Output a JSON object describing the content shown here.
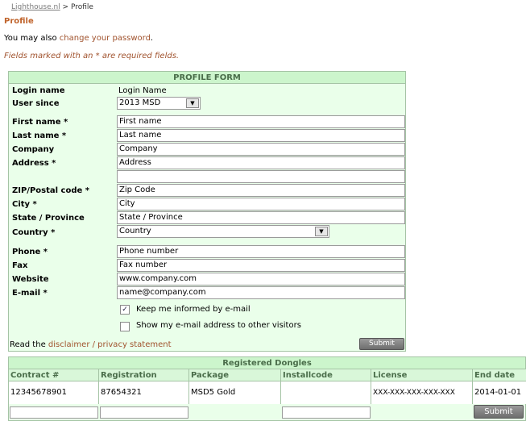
{
  "breadcrumb": {
    "home": "Lighthouse.nl",
    "separator": ">",
    "current": "Profile"
  },
  "page_title": "Profile",
  "intro": {
    "prefix": "You may also ",
    "link": "change your password",
    "suffix": "."
  },
  "required_note": "Fields marked with an * are required fields.",
  "form": {
    "header": "PROFILE FORM",
    "login_name_label": "Login name",
    "login_name_value": "Login Name",
    "user_since_label": "User since",
    "user_since_value": "2013 MSD",
    "first_name_label": "First name *",
    "first_name_value": "First name",
    "last_name_label": "Last name *",
    "last_name_value": "Last name",
    "company_label": "Company",
    "company_value": "Company",
    "address_label": "Address *",
    "address_value": "Address",
    "address2_value": "",
    "zip_label": "ZIP/Postal code *",
    "zip_value": "Zip Code",
    "city_label": "City *",
    "city_value": "City",
    "state_label": "State / Province",
    "state_value": "State / Province",
    "country_label": "Country *",
    "country_value": "Country",
    "phone_label": "Phone *",
    "phone_value": "Phone number",
    "fax_label": "Fax",
    "fax_value": "Fax number",
    "website_label": "Website",
    "website_value": "www.company.com",
    "email_label": "E-mail *",
    "email_value": "name@company.com",
    "keep_informed_label": "Keep me informed by e-mail",
    "keep_informed_checked": true,
    "show_email_label": "Show my e-mail address to other visitors",
    "show_email_checked": false,
    "disclaimer_prefix": "Read the ",
    "disclaimer_link": "disclaimer / privacy statement",
    "submit_label": "Submit"
  },
  "dongles": {
    "header": "Registered Dongles",
    "columns": [
      "Contract #",
      "Registration",
      "Package",
      "Installcode",
      "License",
      "End date"
    ],
    "row": {
      "contract": "12345678901",
      "registration": "87654321",
      "package": "MSD5 Gold",
      "installcode": "",
      "license": "XXX-XXX-XXX-XXX-XXX",
      "end_date": "2014-01-01"
    },
    "submit_label": "Submit"
  },
  "colors": {
    "link": "#a0522d",
    "title": "#c0642c",
    "panel_bg": "#eaffea",
    "panel_header": "#ccf5cc"
  }
}
